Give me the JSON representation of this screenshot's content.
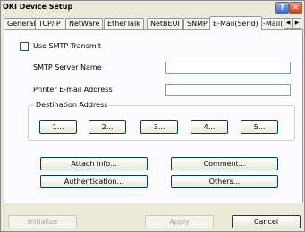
{
  "window": {
    "title": "OKI Device Setup",
    "help_label": "?",
    "close_label": "✕"
  },
  "tabs": [
    {
      "label": "General"
    },
    {
      "label": "TCP/IP"
    },
    {
      "label": "NetWare"
    },
    {
      "label": "EtherTalk"
    },
    {
      "label": "NetBEUI"
    },
    {
      "label": "SNMP"
    },
    {
      "label": "E-Mail(Send)"
    },
    {
      "label": "E-Mail(I"
    }
  ],
  "tab_scroll": {
    "left": "◀",
    "right": "▶"
  },
  "email": {
    "use_smtp_label": "Use SMTP Transmit",
    "smtp_server_label": "SMTP Server Name",
    "smtp_server_value": "",
    "printer_email_label": "Printer E-mail Address",
    "printer_email_value": "",
    "destination_title": "Destination Address",
    "destination_buttons": [
      "1...",
      "2...",
      "3...",
      "4...",
      "5..."
    ],
    "attach_info": "Attach Info...",
    "comment": "Comment...",
    "authentication": "Authentication...",
    "others": "Others..."
  },
  "footer": {
    "initialize": "Initialize",
    "apply": "Apply",
    "cancel": "Cancel"
  }
}
